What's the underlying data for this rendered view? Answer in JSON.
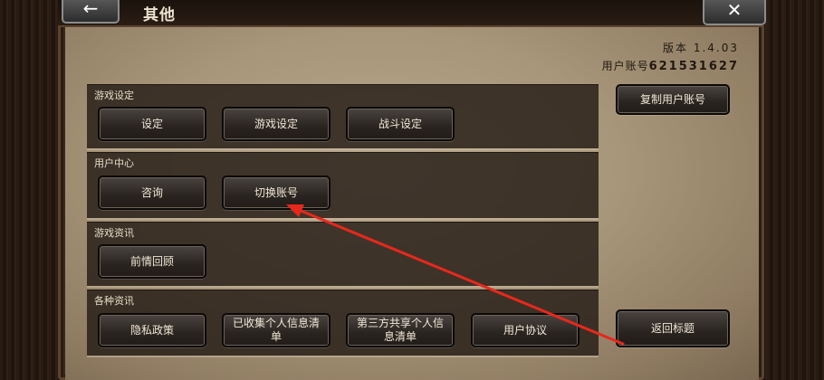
{
  "header": {
    "title": "其他",
    "back_icon": "←",
    "close_icon": "✕"
  },
  "info": {
    "version": "版本 1.4.03",
    "account_label": "用户账号",
    "account_number": "621531627"
  },
  "sections": [
    {
      "label": "游戏设定",
      "buttons": [
        "设定",
        "游戏设定",
        "战斗设定"
      ]
    },
    {
      "label": "用户中心",
      "buttons": [
        "咨询",
        "切换账号"
      ]
    },
    {
      "label": "游戏资讯",
      "buttons": [
        "前情回顾"
      ]
    },
    {
      "label": "各种资讯",
      "buttons": [
        "隐私政策",
        "已收集个人信息清单",
        "第三方共享个人信息清单",
        "用户协议"
      ]
    }
  ],
  "side_buttons": {
    "copy_account": "复制用户账号",
    "return_title": "返回标题"
  },
  "annotation": {
    "color": "#e8281c"
  }
}
